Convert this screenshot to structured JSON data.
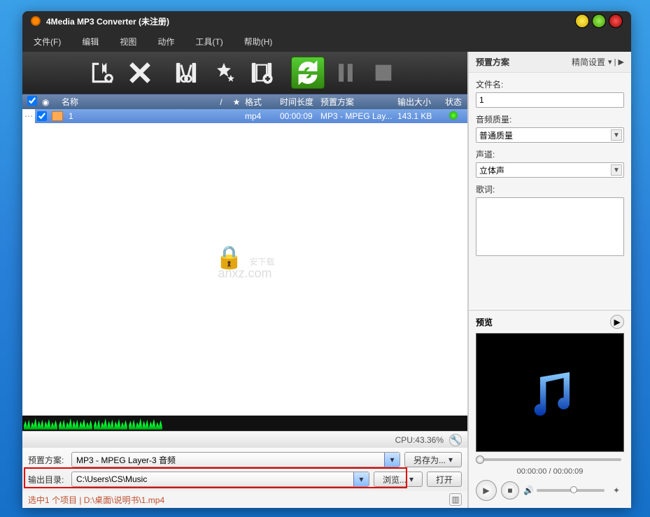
{
  "window": {
    "title": "4Media MP3 Converter (未注册)"
  },
  "menu": {
    "file": "文件(F)",
    "edit": "编辑",
    "view": "视图",
    "action": "动作",
    "tools": "工具(T)",
    "help": "帮助(H)"
  },
  "cols": {
    "name": "名称",
    "slash": "/",
    "star": "★",
    "format": "格式",
    "duration": "时间长度",
    "preset": "预置方案",
    "size": "输出大小",
    "status": "状态"
  },
  "row": {
    "name": "1",
    "format": "mp4",
    "duration": "00:00:09",
    "preset": "MP3 - MPEG Lay...",
    "size": "143.1 KB"
  },
  "cpu": {
    "label": "CPU:43.36%"
  },
  "form": {
    "preset_label": "预置方案:",
    "preset_value": "MP3 - MPEG Layer-3 音频",
    "saveas": "另存为...",
    "outdir_label": "输出目录:",
    "outdir_value": "C:\\Users\\CS\\Music",
    "browse": "浏览...",
    "open": "打开"
  },
  "status": {
    "text": "选中1 个项目 | D:\\桌面\\说明书\\1.mp4"
  },
  "right": {
    "preset_title": "预置方案",
    "simple": "精简设置",
    "filename_label": "文件名:",
    "filename_value": "1",
    "quality_label": "音频质量:",
    "quality_value": "普通质量",
    "channel_label": "声道:",
    "channel_value": "立体声",
    "lyric_label": "歌词:"
  },
  "preview": {
    "title": "预览",
    "time": "00:00:00 / 00:00:09"
  },
  "watermark": {
    "main": "安下载",
    "sub": "anxz.com"
  }
}
